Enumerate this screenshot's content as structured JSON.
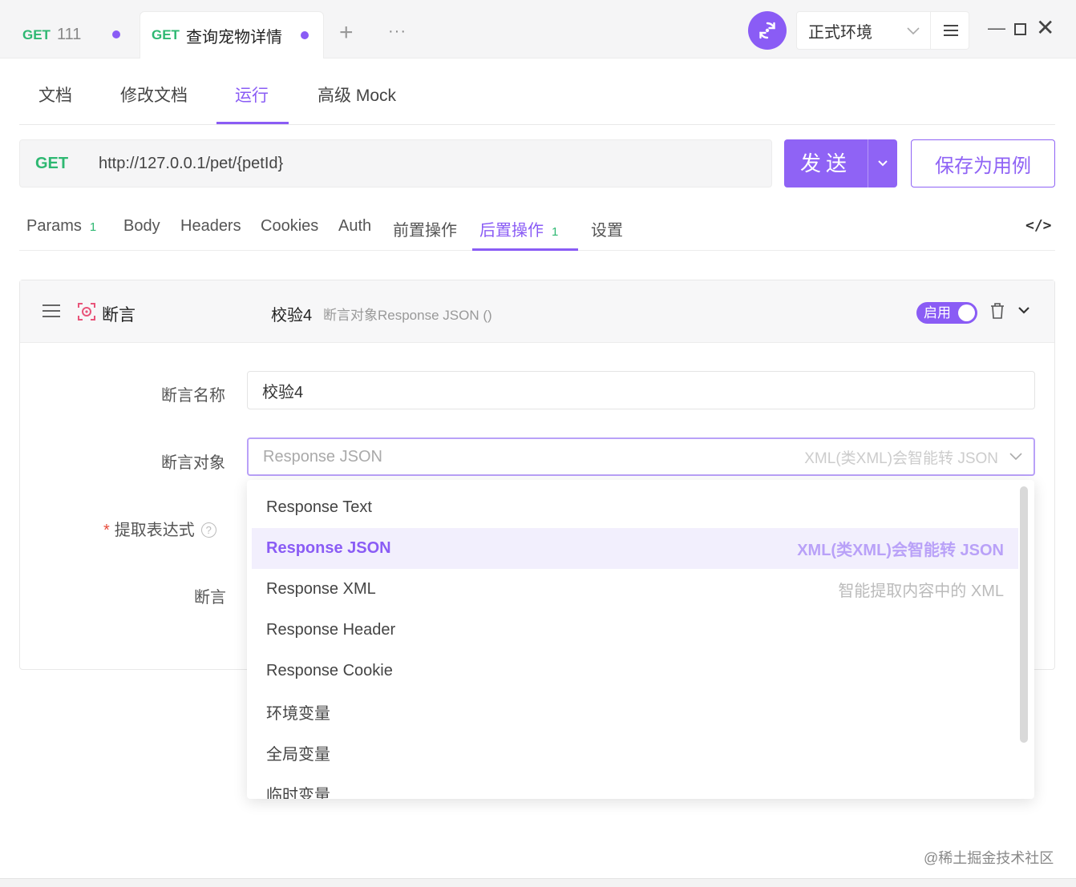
{
  "tabs": [
    {
      "method": "GET",
      "title": "111"
    },
    {
      "method": "GET",
      "title": "查询宠物详情"
    }
  ],
  "tab_add_icon": "+",
  "tab_more_icon": "···",
  "environment": "正式环境",
  "sub_tabs": [
    "文档",
    "修改文档",
    "运行",
    "高级 Mock"
  ],
  "request": {
    "method": "GET",
    "url": "http://127.0.0.1/pet/{petId}",
    "send_label": "发送",
    "save_label": "保存为用例"
  },
  "request_tabs": {
    "params": "Params",
    "params_badge": "1",
    "body": "Body",
    "headers": "Headers",
    "cookies": "Cookies",
    "auth": "Auth",
    "pre": "前置操作",
    "post": "后置操作",
    "post_badge": "1",
    "settings": "设置"
  },
  "code_icon": "</>",
  "assertion": {
    "type_label": "断言",
    "name": "校验4",
    "summary": "断言对象Response JSON ()",
    "toggle_label": "启用",
    "name_label": "断言名称",
    "name_value": "校验4",
    "target_label": "断言对象",
    "target_value": "Response JSON",
    "target_hint": "XML(类XML)会智能转 JSON",
    "expr_required_mark": "*",
    "expr_label": "提取表达式",
    "expr_help": "?",
    "assert_label": "断言"
  },
  "dropdown_options": [
    {
      "label": "Response Text",
      "hint": ""
    },
    {
      "label": "Response JSON",
      "hint": "XML(类XML)会智能转 JSON"
    },
    {
      "label": "Response XML",
      "hint": "智能提取内容中的 XML"
    },
    {
      "label": "Response Header",
      "hint": ""
    },
    {
      "label": "Response Cookie",
      "hint": ""
    },
    {
      "label": "环境变量",
      "hint": ""
    },
    {
      "label": "全局变量",
      "hint": ""
    },
    {
      "label": "临时变量",
      "hint": ""
    }
  ],
  "watermark": "@稀土掘金技术社区",
  "colors": {
    "accent": "#8a5cf5",
    "get": "#2eb872",
    "required": "#e74c3c"
  }
}
